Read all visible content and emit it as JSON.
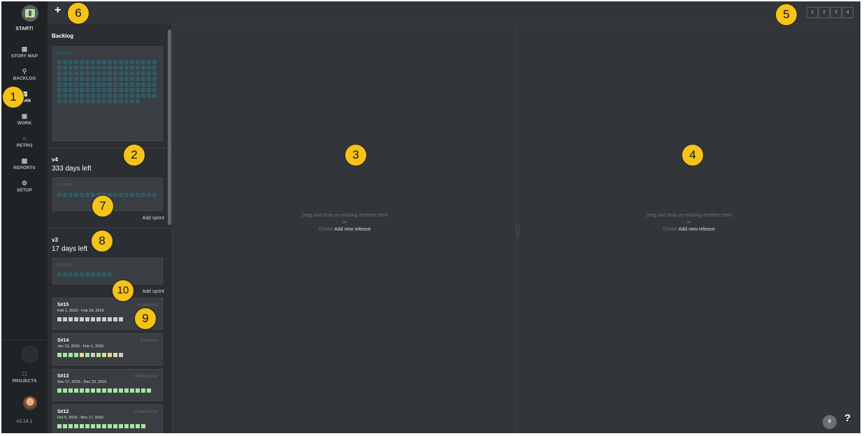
{
  "sidebar": {
    "start": "START!",
    "items": [
      {
        "label": "STORY MAP",
        "icon": "grid-icon"
      },
      {
        "label": "BACKLOG",
        "icon": "lightbulb-icon"
      },
      {
        "label": "PLAN",
        "icon": "calendar-icon",
        "active": true
      },
      {
        "label": "WORK",
        "icon": "briefcase-icon"
      },
      {
        "label": "RETRO",
        "icon": "chat-icon"
      },
      {
        "label": "REPORTS",
        "icon": "bar-chart-icon"
      },
      {
        "label": "SETUP",
        "icon": "gear-icon"
      }
    ],
    "projects": "PROJECTS",
    "version": "v3.14.1"
  },
  "topbar": {
    "add": "+",
    "pages": [
      "1",
      "2",
      "3",
      "4"
    ]
  },
  "backlog": {
    "title": "Backlog",
    "icebox_label": "Icebox",
    "icebox_count": 141
  },
  "releases": [
    {
      "name": "v4",
      "days_left": "333 days left",
      "icebox_label": "Icebox",
      "icebox_count": 18,
      "add_sprint": "Add sprint"
    },
    {
      "name": "v3",
      "days_left": "17 days left",
      "icebox_label": "Icebox",
      "icebox_count": 10,
      "add_sprint": "Add sprint"
    }
  ],
  "sprints": [
    {
      "name": "S#15",
      "dates": "Feb 1, 2016 - Feb 19, 2016",
      "status": "PLANNING",
      "squares": [
        "#c9cdd0",
        "#c9cdd0",
        "#c9cdd0",
        "#c9cdd0",
        "#c9cdd0",
        "#c9cdd0",
        "#c9cdd0",
        "#c9cdd0",
        "#c9cdd0",
        "#c9cdd0",
        "#c9cdd0",
        "#c9cdd0"
      ]
    },
    {
      "name": "S#14",
      "dates": "Jan 13, 2016 - Feb 1, 2016",
      "status": "RUNNING",
      "squares": [
        "#a6e6a0",
        "#a6e6a0",
        "#a6e6a0",
        "#a6e6a0",
        "#e6d49a",
        "#a6e6a0",
        "#c9cdd0",
        "#a6e6a0",
        "#e6d49a",
        "#e6d49a",
        "#e6d49a",
        "#c9cdd0"
      ]
    },
    {
      "name": "S#13",
      "dates": "Nov 17, 2015 - Dec 23, 2015",
      "status": "COMPLETED",
      "squares": [
        "#a6e6a0",
        "#a6e6a0",
        "#a6e6a0",
        "#a6e6a0",
        "#a6e6a0",
        "#a6e6a0",
        "#a6e6a0",
        "#a6e6a0",
        "#a6e6a0",
        "#a6e6a0",
        "#a6e6a0",
        "#a6e6a0",
        "#a6e6a0",
        "#a6e6a0",
        "#a6e6a0",
        "#a6e6a0",
        "#a6e6a0"
      ]
    },
    {
      "name": "S#12",
      "dates": "Oct 5, 2015 - Nov 17, 2015",
      "status": "COMPLETED",
      "squares": [
        "#a6e6a0",
        "#a6e6a0",
        "#a6e6a0",
        "#a6e6a0",
        "#a6e6a0",
        "#a6e6a0",
        "#a6e6a0",
        "#a6e6a0",
        "#a6e6a0",
        "#a6e6a0",
        "#a6e6a0",
        "#a6e6a0",
        "#a6e6a0",
        "#a6e6a0",
        "#a6e6a0",
        "#a6e6a0"
      ]
    }
  ],
  "dropzones": [
    {
      "line1": "Drag and drop an existing iteration here",
      "line2": "or",
      "create": "Create",
      "add_release": "Add new release"
    },
    {
      "line1": "Drag and drop an existing iteration here",
      "line2": "or",
      "create": "Create",
      "add_release": "Add new release"
    }
  ],
  "footer": {
    "badge_count": "0",
    "help": "?"
  },
  "callouts": [
    "1",
    "2",
    "3",
    "4",
    "5",
    "6",
    "7",
    "8",
    "9",
    "10"
  ]
}
